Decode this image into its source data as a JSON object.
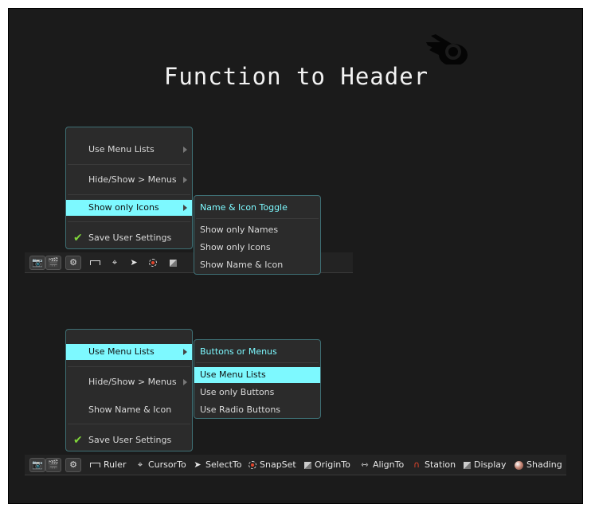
{
  "title": "Function to Header",
  "top_menu": {
    "items": [
      {
        "label": "Use Menu Lists",
        "has_submenu": true
      },
      {
        "label": "Hide/Show > Menus",
        "has_submenu": true
      },
      {
        "label": "Show only Icons",
        "has_submenu": true,
        "highlighted": true
      },
      {
        "label": "Save User Settings",
        "checked": true
      }
    ],
    "submenu": {
      "heading": "Name & Icon Toggle",
      "items": [
        "Show only Names",
        "Show only Icons",
        "Show Name & Icon"
      ]
    }
  },
  "bottom_menu": {
    "items": [
      {
        "label": "Use Menu Lists",
        "has_submenu": true,
        "highlighted": true
      },
      {
        "label": "Hide/Show > Menus",
        "has_submenu": true
      },
      {
        "label": "Show Name & Icon"
      },
      {
        "label": "Save User Settings",
        "checked": true
      }
    ],
    "submenu": {
      "heading": "Buttons or Menus",
      "items": [
        "Use Menu Lists",
        "Use only Buttons",
        "Use Radio Buttons"
      ],
      "highlighted_index": 0
    }
  },
  "bottom_header": {
    "tools": [
      "Ruler",
      "CursorTo",
      "SelectTo",
      "SnapSet",
      "OriginTo",
      "AlignTo",
      "Station",
      "Display",
      "Shading"
    ]
  },
  "colors": {
    "highlight": "#7df9ff",
    "background": "#1b1b1b",
    "check": "#7fd43a"
  }
}
